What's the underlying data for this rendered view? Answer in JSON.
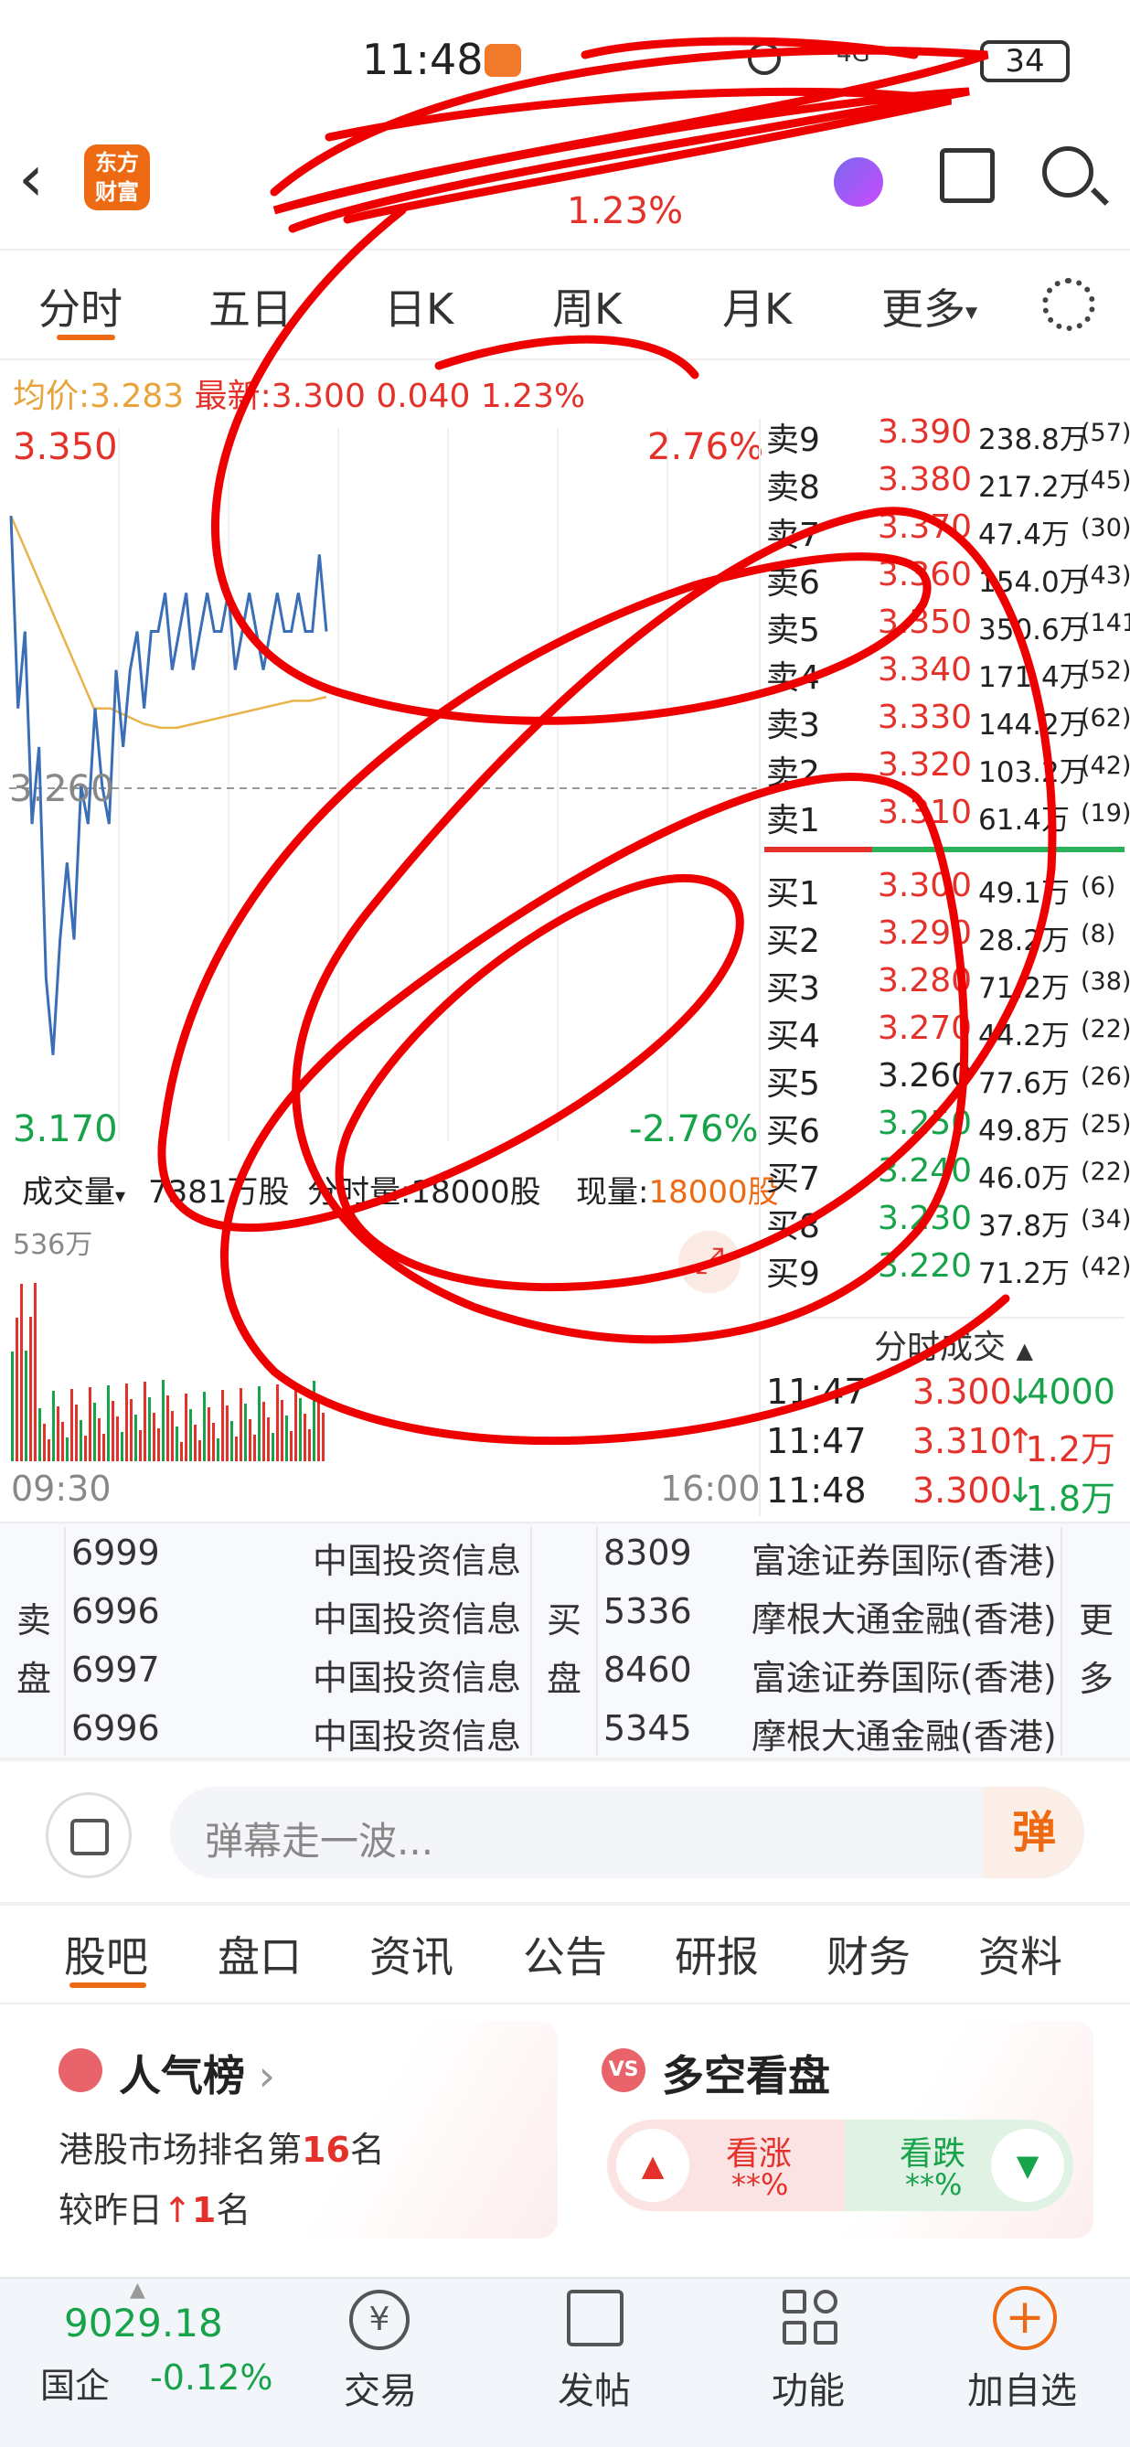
{
  "status": {
    "time": "11:48",
    "net": "4G",
    "battery": "34"
  },
  "header": {
    "logo_line1": "东方",
    "logo_line2": "财富",
    "subtitle_change": "1.23%"
  },
  "tabs": [
    "分时",
    "五日",
    "日K",
    "周K",
    "月K",
    "更多"
  ],
  "summary": {
    "avg_label": "均价:",
    "avg": "3.283",
    "last_label": "最新:",
    "last": "3.300",
    "change": "0.040",
    "pct": "1.23%"
  },
  "chart": {
    "max": "3.350",
    "max_pct": "2.76%",
    "mid": "3.260",
    "min": "3.170",
    "min_pct": "-2.76%",
    "time_start": "09:30",
    "time_end": "16:00",
    "vol_max": "536万"
  },
  "chart_data": {
    "type": "line",
    "ylim": [
      3.17,
      3.35
    ],
    "prev_close": 3.26,
    "price": [
      3.33,
      3.28,
      3.3,
      3.25,
      3.27,
      3.21,
      3.19,
      3.22,
      3.24,
      3.22,
      3.26,
      3.25,
      3.28,
      3.26,
      3.25,
      3.29,
      3.27,
      3.29,
      3.3,
      3.28,
      3.3,
      3.3,
      3.31,
      3.29,
      3.3,
      3.31,
      3.29,
      3.3,
      3.31,
      3.3,
      3.3,
      3.31,
      3.29,
      3.3,
      3.31,
      3.3,
      3.29,
      3.3,
      3.31,
      3.3,
      3.3,
      3.31,
      3.3,
      3.3,
      3.32,
      3.3
    ],
    "avg": [
      3.33,
      3.32,
      3.31,
      3.3,
      3.29,
      3.28,
      3.28,
      3.278,
      3.276,
      3.275,
      3.275,
      3.276,
      3.277,
      3.278,
      3.279,
      3.28,
      3.281,
      3.282,
      3.282,
      3.283
    ]
  },
  "volume_bar": {
    "label": "成交量",
    "total": "7381万股",
    "minute": "分时量:18000股",
    "now_label": "现量:",
    "now": "18000股"
  },
  "asks": [
    {
      "label": "卖9",
      "price": "3.390",
      "vol": "238.8万",
      "cnt": "(57)"
    },
    {
      "label": "卖8",
      "price": "3.380",
      "vol": "217.2万",
      "cnt": "(45)"
    },
    {
      "label": "卖7",
      "price": "3.370",
      "vol": "47.4万",
      "cnt": "(30)"
    },
    {
      "label": "卖6",
      "price": "3.360",
      "vol": "154.0万",
      "cnt": "(43)"
    },
    {
      "label": "卖5",
      "price": "3.350",
      "vol": "350.6万",
      "cnt": "(141)"
    },
    {
      "label": "卖4",
      "price": "3.340",
      "vol": "171.4万",
      "cnt": "(52)"
    },
    {
      "label": "卖3",
      "price": "3.330",
      "vol": "144.2万",
      "cnt": "(62)"
    },
    {
      "label": "卖2",
      "price": "3.320",
      "vol": "103.2万",
      "cnt": "(42)"
    },
    {
      "label": "卖1",
      "price": "3.310",
      "vol": "61.4万",
      "cnt": "(19)"
    }
  ],
  "bids": [
    {
      "label": "买1",
      "price": "3.300",
      "vol": "49.1万",
      "cnt": "(6)"
    },
    {
      "label": "买2",
      "price": "3.290",
      "vol": "28.2万",
      "cnt": "(8)"
    },
    {
      "label": "买3",
      "price": "3.280",
      "vol": "71.2万",
      "cnt": "(38)"
    },
    {
      "label": "买4",
      "price": "3.270",
      "vol": "44.2万",
      "cnt": "(22)"
    },
    {
      "label": "买5",
      "price": "3.260",
      "vol": "77.6万",
      "cnt": "(26)"
    },
    {
      "label": "买6",
      "price": "3.250",
      "vol": "49.8万",
      "cnt": "(25)"
    },
    {
      "label": "买7",
      "price": "3.240",
      "vol": "46.0万",
      "cnt": "(22)"
    },
    {
      "label": "买8",
      "price": "3.230",
      "vol": "37.8万",
      "cnt": "(34)"
    },
    {
      "label": "买9",
      "price": "3.220",
      "vol": "71.2万",
      "cnt": "(42)"
    }
  ],
  "ticks_title": "分时成交",
  "ticks": [
    {
      "time": "11:47",
      "price": "3.300",
      "arrow": "↓",
      "vol": "4000"
    },
    {
      "time": "11:47",
      "price": "3.310",
      "arrow": "↑",
      "vol": "1.2万"
    },
    {
      "time": "11:48",
      "price": "3.300",
      "arrow": "↓",
      "vol": "1.8万"
    }
  ],
  "brokers": {
    "sell_label1": "卖",
    "sell_label2": "盘",
    "buy_label1": "买",
    "buy_label2": "盘",
    "more1": "更",
    "more2": "多",
    "sell": [
      {
        "code": "6999",
        "name": "中国投资信息"
      },
      {
        "code": "6996",
        "name": "中国投资信息"
      },
      {
        "code": "6997",
        "name": "中国投资信息"
      },
      {
        "code": "6996",
        "name": "中国投资信息"
      }
    ],
    "buy": [
      {
        "code": "8309",
        "name": "富途证券国际(香港)"
      },
      {
        "code": "5336",
        "name": "摩根大通金融(香港)"
      },
      {
        "code": "8460",
        "name": "富途证券国际(香港)"
      },
      {
        "code": "5345",
        "name": "摩根大通金融(香港)"
      }
    ]
  },
  "danmaku": {
    "placeholder": "弹幕走一波...",
    "button": "弹"
  },
  "feature_tabs": [
    "股吧",
    "盘口",
    "资讯",
    "公告",
    "研报",
    "财务",
    "资料"
  ],
  "popularity": {
    "title": "人气榜",
    "line1_pre": "港股市场排名第",
    "rank": "16",
    "line1_post": "名",
    "line2_pre": "较昨日",
    "change": "1",
    "line2_post": "名"
  },
  "bullbear": {
    "title": "多空看盘",
    "up": "看涨",
    "up_val": "**%",
    "down": "看跌",
    "down_val": "**%"
  },
  "bottom": {
    "index_value": "9029.18",
    "index_name": "国企",
    "index_pct": "-0.12%",
    "nav": [
      "交易",
      "发帖",
      "功能",
      "加自选"
    ]
  }
}
